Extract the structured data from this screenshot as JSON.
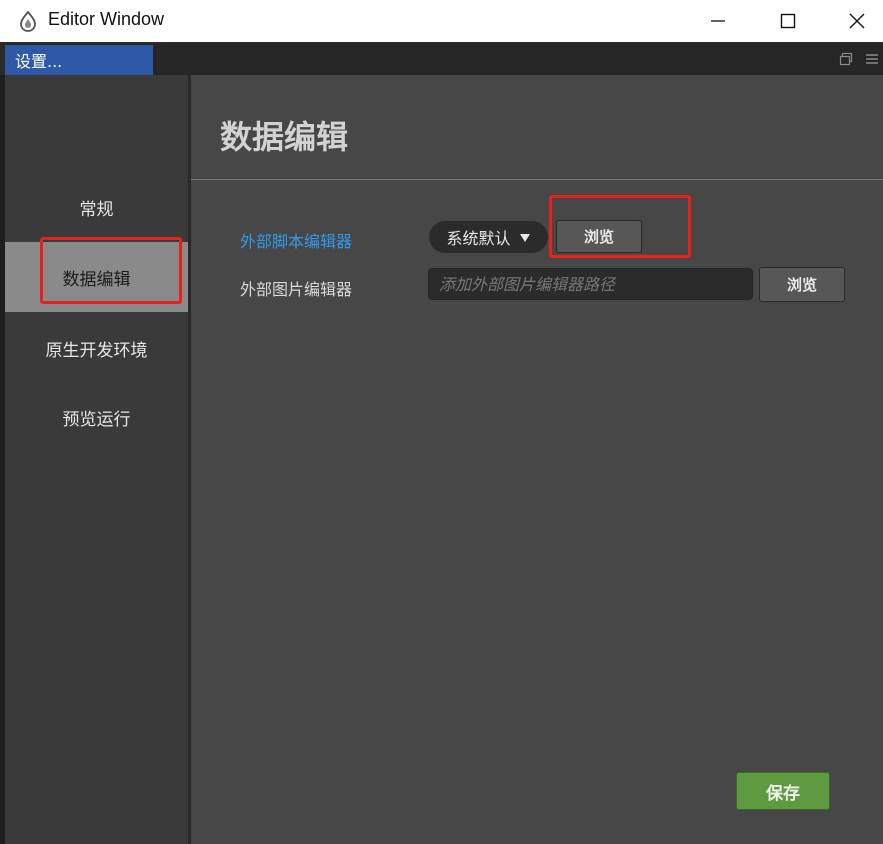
{
  "window": {
    "title": "Editor Window"
  },
  "tabs": {
    "active_label": "设置..."
  },
  "sidebar": {
    "items": [
      {
        "label": "常规",
        "active": false
      },
      {
        "label": "数据编辑",
        "active": true
      },
      {
        "label": "原生开发环境",
        "active": false
      },
      {
        "label": "预览运行",
        "active": false
      }
    ]
  },
  "main": {
    "title": "数据编辑",
    "script_editor": {
      "label": "外部脚本编辑器",
      "dropdown_value": "系统默认",
      "browse_label": "浏览"
    },
    "image_editor": {
      "label": "外部图片编辑器",
      "placeholder": "添加外部图片编辑器路径",
      "browse_label": "浏览"
    },
    "save_label": "保存"
  },
  "colors": {
    "accent_blue": "#2d59a8",
    "link_blue": "#2f9be8",
    "save_green": "#5e9a3f",
    "highlight_red": "#e8211b"
  },
  "icons": [
    "app-icon",
    "minimize-icon",
    "maximize-icon",
    "close-icon",
    "restore-panel-icon",
    "menu-icon",
    "dropdown-arrow-icon"
  ]
}
